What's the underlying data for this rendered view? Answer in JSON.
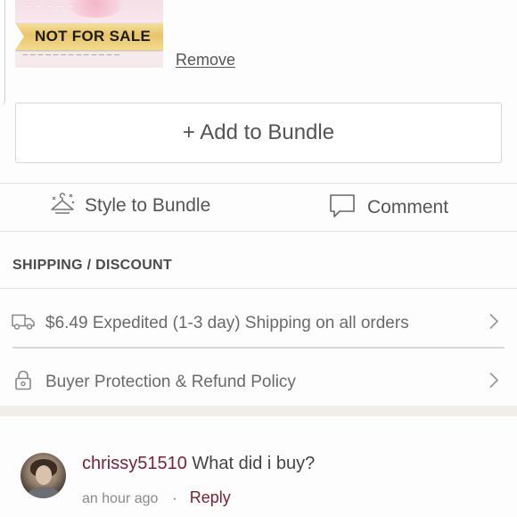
{
  "item": {
    "banner_text": "NOT FOR SALE",
    "remove_label": "Remove"
  },
  "add_bundle": {
    "label": "+ Add to Bundle"
  },
  "actions": {
    "style_label": "Style to Bundle",
    "comment_label": "Comment"
  },
  "shipping": {
    "section_title": "SHIPPING / DISCOUNT",
    "shipping_text": "$6.49 Expedited (1-3 day) Shipping on all orders",
    "protection_text": "Buyer Protection & Refund Policy"
  },
  "comment": {
    "username": "chrissy51510",
    "text": "What did i buy?",
    "timestamp": "an hour ago",
    "separator": "·",
    "reply_label": "Reply"
  },
  "colors": {
    "accent": "#7a2134",
    "banner_gold": "#e8c46a"
  },
  "icons": {
    "style": "hanger-sparkle-icon",
    "comment": "speech-bubble-icon",
    "shipping": "truck-icon",
    "protection": "lock-icon",
    "chevron": "chevron-right-icon"
  }
}
